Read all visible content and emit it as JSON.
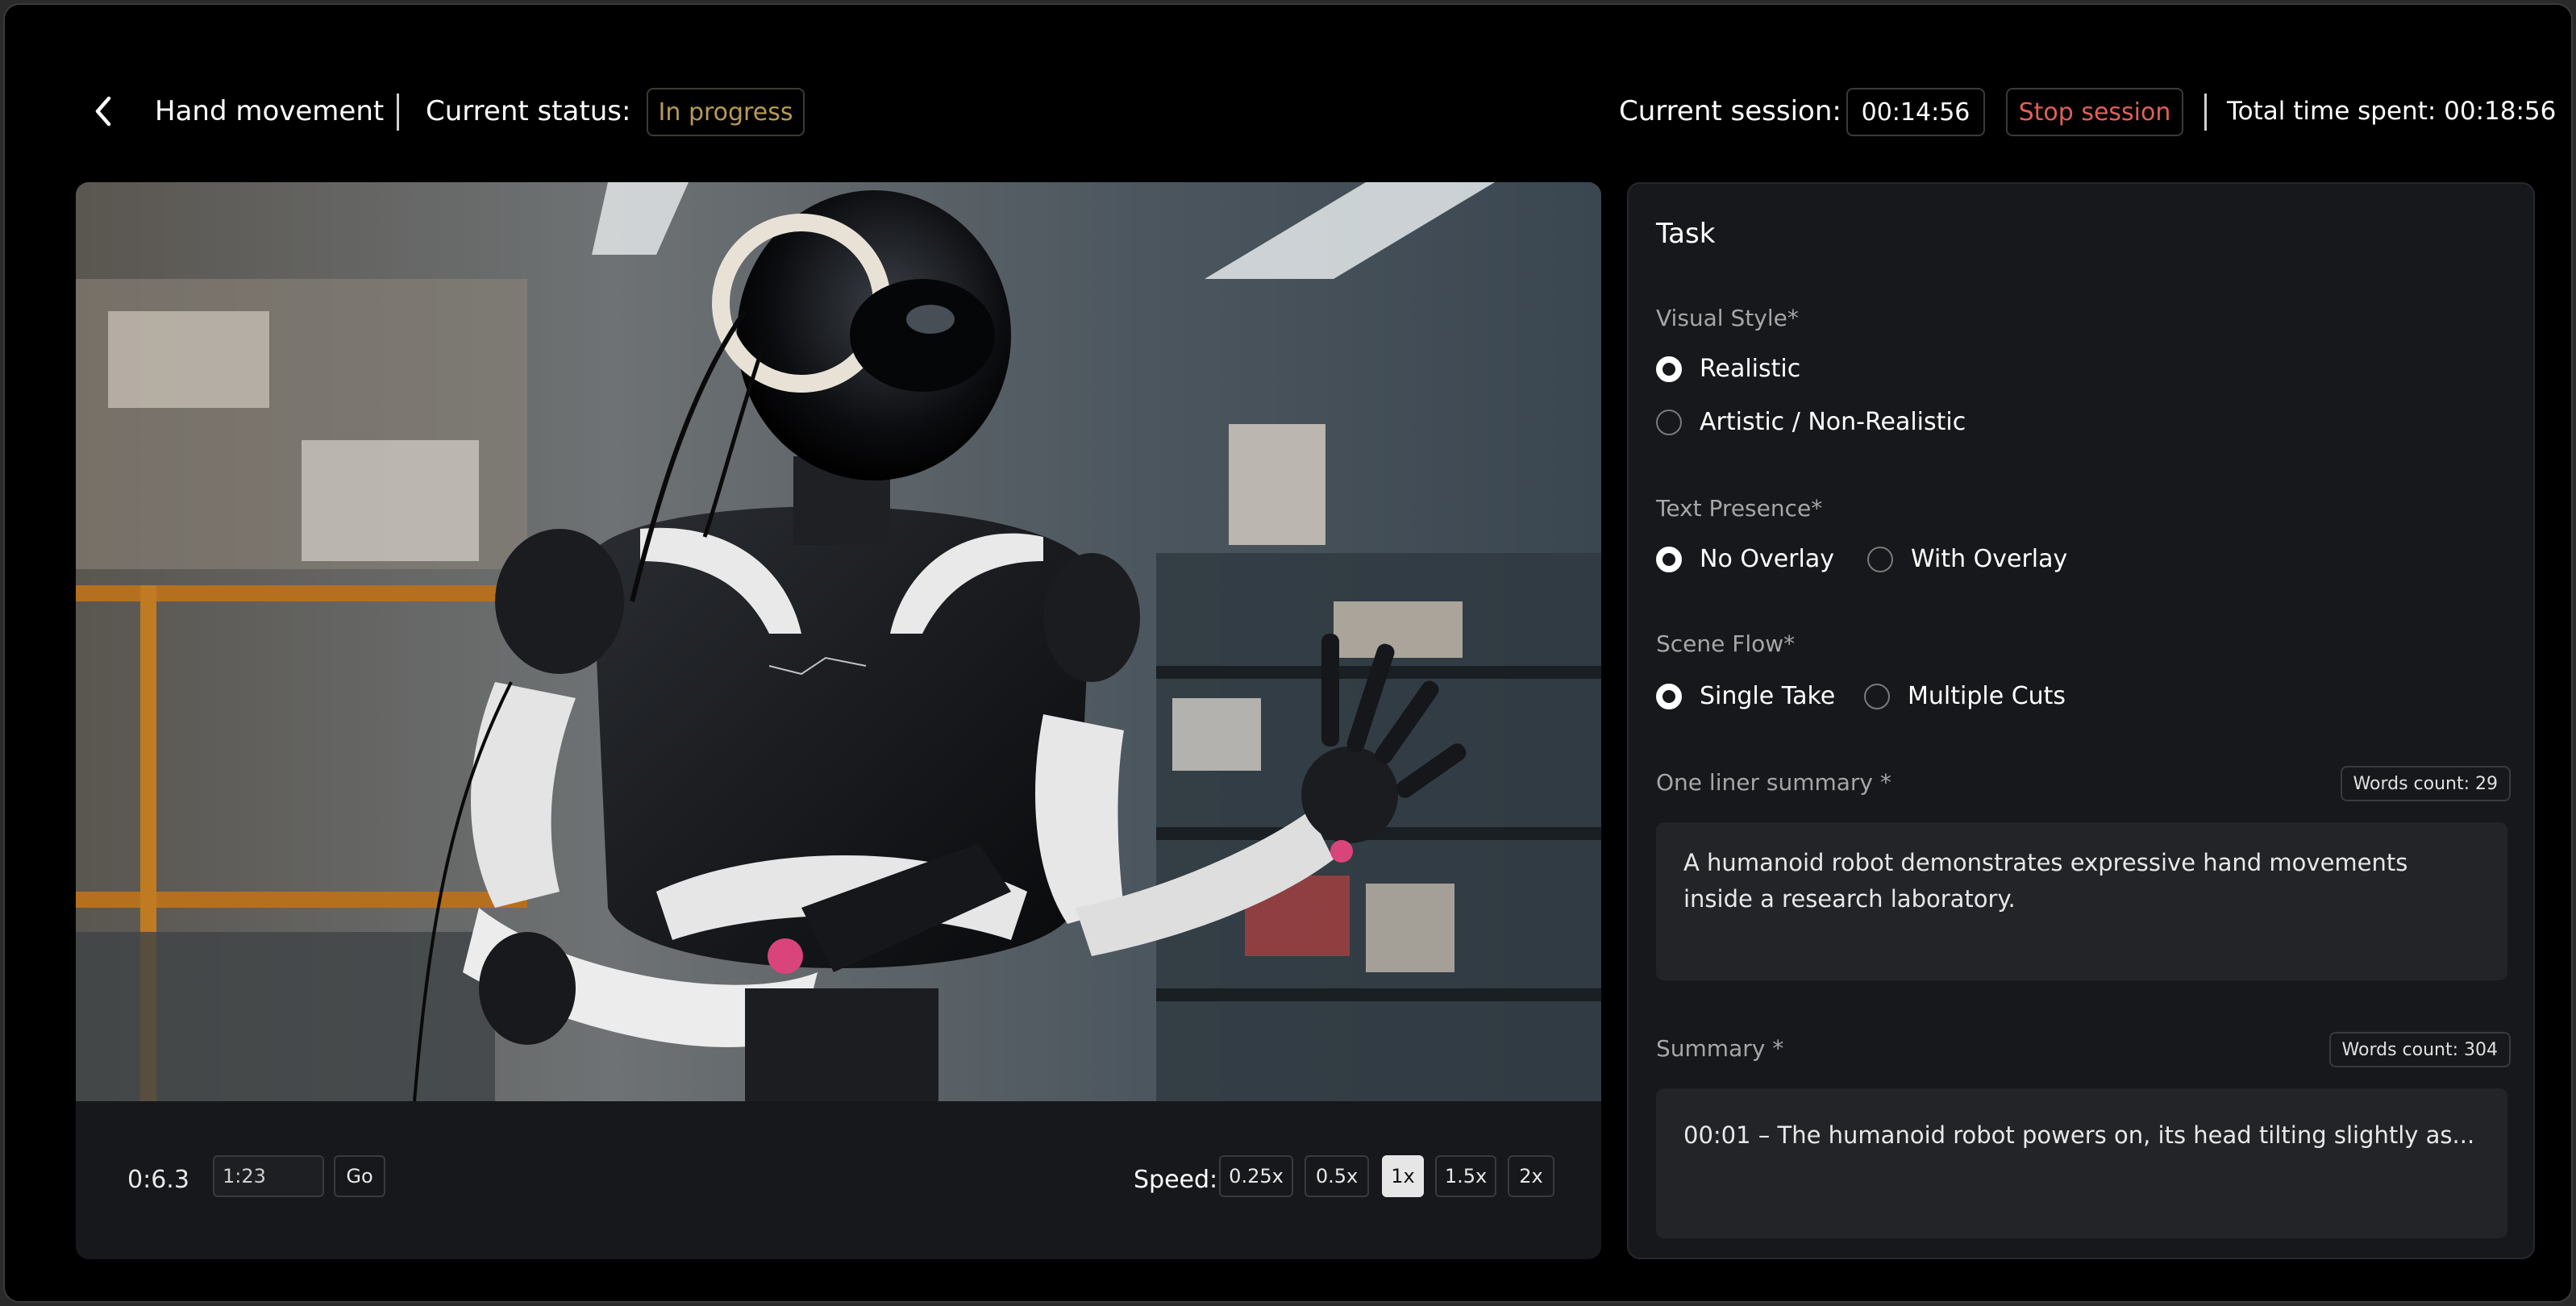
{
  "header": {
    "title": "Hand movement",
    "status_label": "Current status:",
    "status_value": "In progress",
    "session_label": "Current session:",
    "session_time": "00:14:56",
    "stop_label": "Stop session",
    "total_time": "Total time spent: 00:18:56"
  },
  "controls": {
    "timecode": "0:6.3",
    "time_input_value": "1:23",
    "go_label": "Go",
    "speed_label": "Speed:",
    "speeds": [
      "0.25x",
      "0.5x",
      "1x",
      "1.5x",
      "2x"
    ],
    "active_speed": "1x"
  },
  "task": {
    "title": "Task",
    "visual_style": {
      "label": "Visual Style*",
      "options": [
        "Realistic",
        "Artistic / Non-Realistic"
      ],
      "selected": "Realistic"
    },
    "text_presence": {
      "label": "Text Presence*",
      "options": [
        "No Overlay",
        "With Overlay"
      ],
      "selected": "No Overlay"
    },
    "scene_flow": {
      "label": "Scene Flow*",
      "options": [
        "Single Take",
        "Multiple Cuts"
      ],
      "selected": "Single Take"
    },
    "one_liner": {
      "label": "One liner summary *",
      "word_count": "Words count: 29",
      "text": "A humanoid robot demonstrates expressive hand movements inside a research laboratory."
    },
    "summary": {
      "label": "Summary *",
      "word_count": "Words count: 304",
      "text": "00:01 – The humanoid robot powers on, its head tilting slightly as..."
    }
  },
  "colors": {
    "background": "#000000",
    "panel": "#16181b",
    "status_text": "#b89a56",
    "stop_text": "#e0605a",
    "active_speed_bg": "#e6e6e6"
  }
}
